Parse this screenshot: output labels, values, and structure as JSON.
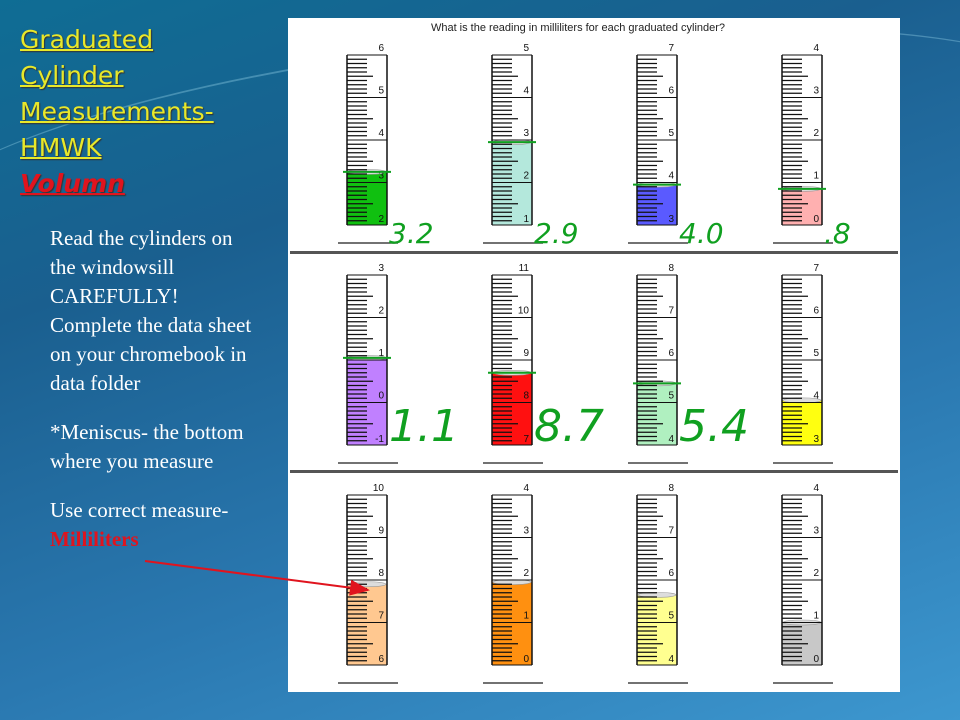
{
  "title": {
    "lines": [
      "Graduated",
      "Cylinder",
      "Measurements-",
      "HMWK"
    ],
    "subtitle": "Volumn"
  },
  "instructions": {
    "p1": "Read the cylinders on the windowsill CAREFULLY! Complete the data sheet on your chromebook in data folder",
    "p2": "*Meniscus- the bottom where you measure",
    "p3_prefix": "Use correct measure-",
    "p3_unit": "Milliliters"
  },
  "worksheet": {
    "question": "What is the reading in milliliters for each graduated cylinder?",
    "cylinders": [
      {
        "min": 2,
        "max": 6,
        "level": 3.25,
        "color": "#10c010",
        "answer": "3.2"
      },
      {
        "min": 1,
        "max": 5,
        "level": 2.95,
        "color": "#b4e8dc",
        "answer": "2.9"
      },
      {
        "min": 3,
        "max": 7,
        "level": 3.95,
        "color": "#5a5aff",
        "answer": "4.0"
      },
      {
        "min": 0,
        "max": 4,
        "level": 0.85,
        "color": "#ffb0b0",
        "answer": ".8"
      },
      {
        "min": -1,
        "max": 3,
        "level": 1.05,
        "color": "#c080ff",
        "answer": "1.1"
      },
      {
        "min": 7,
        "max": 11,
        "level": 8.7,
        "color": "#ff1010",
        "answer": "8.7"
      },
      {
        "min": 4,
        "max": 8,
        "level": 5.45,
        "color": "#b0f0c0",
        "answer": "5.4"
      },
      {
        "min": 3,
        "max": 7,
        "level": 4.05,
        "color": "#ffff10",
        "answer": ""
      },
      {
        "min": 6,
        "max": 10,
        "level": 7.9,
        "color": "#ffc890",
        "answer": ""
      },
      {
        "min": 0,
        "max": 4,
        "level": 1.95,
        "color": "#ff9010",
        "answer": ""
      },
      {
        "min": 4,
        "max": 8,
        "level": 5.65,
        "color": "#ffff90",
        "answer": ""
      },
      {
        "min": 0,
        "max": 4,
        "level": 1.0,
        "color": "#c8c8c8",
        "answer": ""
      }
    ]
  },
  "colors": {
    "answer_ink": "#10a020",
    "arrow": "#e0141e",
    "title": "#e8e82a"
  }
}
